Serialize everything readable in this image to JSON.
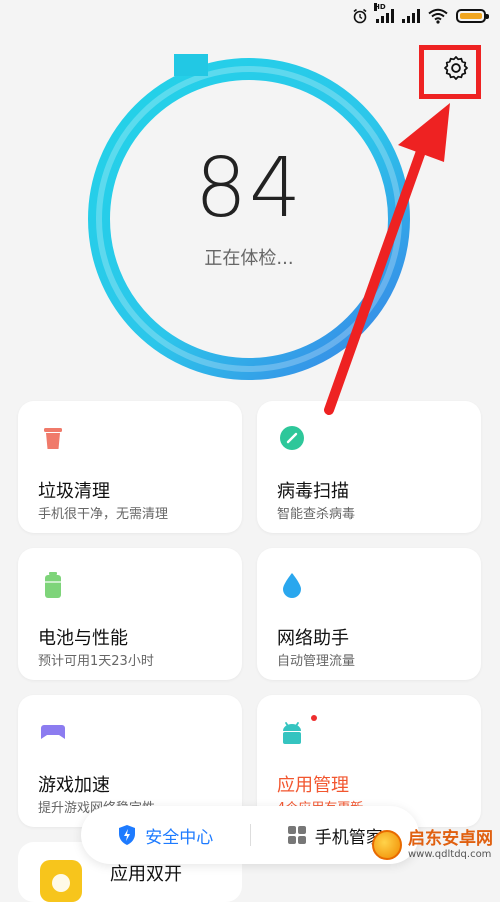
{
  "status_bar": {
    "hd_label": "HD",
    "battery_color": "#f0a51f"
  },
  "header": {
    "settings_icon": "gear-icon"
  },
  "score": {
    "value": "84",
    "status_text": "正在体检...",
    "ring_colors": [
      "#1ecfe6",
      "#3b8fe8"
    ]
  },
  "cards": [
    {
      "icon": "trash-icon",
      "icon_color": "#f07a6a",
      "title": "垃圾清理",
      "subtitle": "手机很干净，无需清理"
    },
    {
      "icon": "virus-scan-icon",
      "icon_color": "#2ec79a",
      "title": "病毒扫描",
      "subtitle": "智能查杀病毒"
    },
    {
      "icon": "battery-icon",
      "icon_color": "#7ed47a",
      "title": "电池与性能",
      "subtitle": "预计可用1天23小时"
    },
    {
      "icon": "water-drop-icon",
      "icon_color": "#2aa7ee",
      "title": "网络助手",
      "subtitle": "自动管理流量"
    },
    {
      "icon": "gamepad-icon",
      "icon_color": "#8c7cf0",
      "title": "游戏加速",
      "subtitle": "提升游戏网络稳定性"
    },
    {
      "icon": "android-icon",
      "icon_color": "#35c4c0",
      "title": "应用管理",
      "subtitle": "4个应用有更新",
      "highlight_color": "#f2562f"
    }
  ],
  "peek_card": {
    "title": "应用双开"
  },
  "bottom_nav": {
    "items": [
      {
        "label": "安全中心",
        "icon": "shield-bolt-icon",
        "active": true
      },
      {
        "label": "手机管家",
        "icon": "grid-icon",
        "active": false
      }
    ]
  },
  "watermark": {
    "main": "启东安卓网",
    "url": "www.qdltdq.com"
  }
}
